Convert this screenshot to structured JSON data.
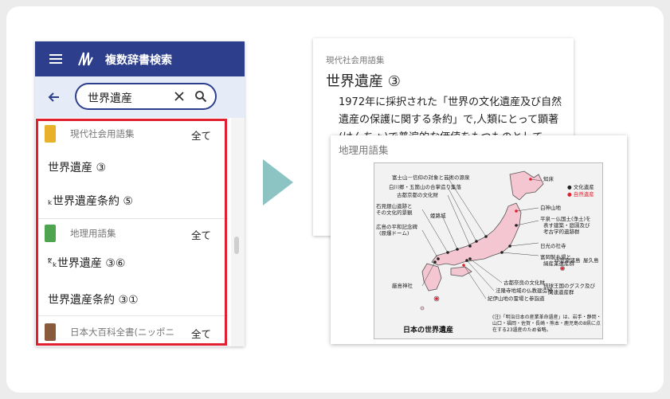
{
  "app": {
    "title": "複数辞書検索",
    "bar_color": "#2c3e8c"
  },
  "search": {
    "value": "世界遺産"
  },
  "results": {
    "groups": [
      {
        "dict": "現代社会用語集",
        "all_label": "全て",
        "icon_color": "#e9b12a",
        "entries": [
          "世界遺産 ③",
          "ₖ世界遺産条約 ⑤"
        ]
      },
      {
        "dict": "地理用語集",
        "all_label": "全て",
        "icon_color": "#4fa54f",
        "entries": [
          "ᵏ̃ₖ世界遺産 ③⑥",
          "世界遺産条約 ③①"
        ]
      },
      {
        "dict": "日本大百科全書(ニッポニ",
        "all_label": "全て",
        "icon_color": "#8a5a3c",
        "entries": []
      }
    ],
    "highlight_color": "#e0202e"
  },
  "doc1": {
    "source": "現代社会用語集",
    "title": "世界遺産 ③",
    "body": "1972年に採択された「世界の文化遺産及び自然遺産の保護に関する条約」で,人類にとって顕著(けんちょ)で普遍的な価値をもつものとして,"
  },
  "doc2": {
    "source": "地理用語集",
    "map_labels": [
      "富士山－信仰の対象と芸術の源泉",
      "白川郷・五箇山の合掌造り集落",
      "古都京都の文化財",
      "石見銀山遺跡と",
      "その文化的景観",
      "姫路城",
      "広島の平和記念碑",
      "(原爆ドーム)",
      "知床",
      "白神山地",
      "平泉－仏国土(浄土)を",
      "表す建築・庭園及び",
      "考古学的遺跡群",
      "日光の社寺",
      "富岡製糸場と",
      "絹産業遺産群",
      "古都奈良の文化財",
      "法隆寺地域の仏教建造物",
      "紀伊山地の霊場と参詣道",
      "厳島神社",
      "小笠原諸島",
      "屋久島",
      "琉球王国のグスク及び",
      "関連遺産群"
    ],
    "legend": [
      "● 文化遺産",
      "● 自然遺産"
    ],
    "legend_colors": [
      "#222222",
      "#e0202e"
    ],
    "caption": "日本の世界遺産",
    "note": "(注)「明治日本の産業革命遺産」は、岩手・静岡・山口・福岡・佐賀・長崎・熊本・鹿児島の8県に点在する23遺産のため省略。"
  }
}
